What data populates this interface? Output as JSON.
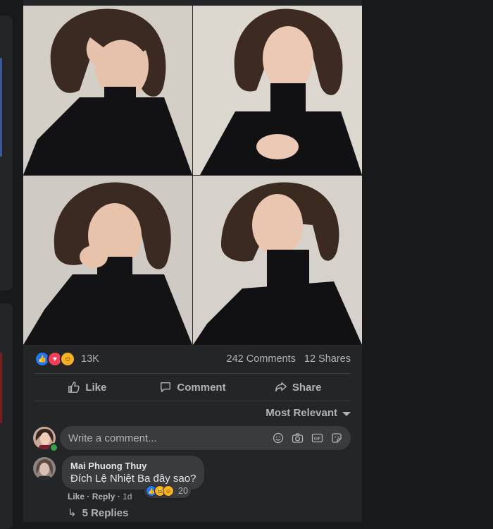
{
  "post": {
    "reactions": {
      "icons": [
        "like-icon",
        "love-icon",
        "care-icon"
      ],
      "count": "13K"
    },
    "comments_count": "242 Comments",
    "shares_count": "12 Shares",
    "actions": {
      "like": "Like",
      "comment": "Comment",
      "share": "Share"
    },
    "sort_label": "Most Relevant",
    "composer": {
      "placeholder": "Write a comment...",
      "icons": [
        "emoji-icon",
        "camera-icon",
        "gif-icon",
        "sticker-icon"
      ]
    }
  },
  "comments": [
    {
      "author": "Mai Phuong Thuy",
      "text": "Đích Lệ Nhiệt Ba đây sao?",
      "reaction_icons": [
        "like-icon",
        "haha-icon",
        "care-icon"
      ],
      "reaction_count": "20",
      "like_label": "Like",
      "reply_label": "Reply",
      "time": "1d",
      "replies_label": "5 Replies"
    }
  ],
  "colors": {
    "background": "#18191a",
    "card": "#242526",
    "bubble": "#3a3b3c",
    "text_primary": "#e4e6eb",
    "text_secondary": "#b0b3b8",
    "like_blue": "#2078f4",
    "love_red": "#f33e58",
    "online_green": "#31a24c"
  }
}
